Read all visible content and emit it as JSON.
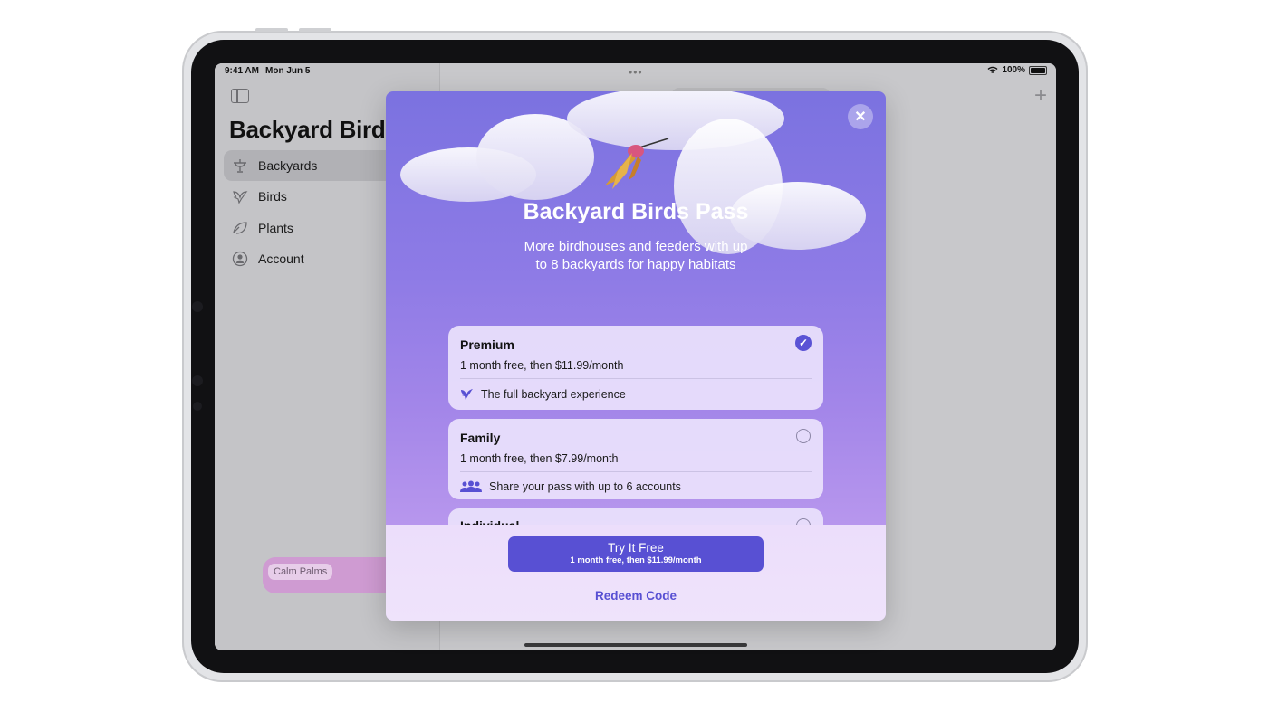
{
  "status_bar": {
    "time": "9:41 AM",
    "date": "Mon Jun 5",
    "battery": "100%"
  },
  "sidebar": {
    "title": "Backyard Birds",
    "items": [
      {
        "label": "Backyards",
        "icon": "birdbath-icon",
        "selected": true
      },
      {
        "label": "Birds",
        "icon": "bird-icon",
        "selected": false
      },
      {
        "label": "Plants",
        "icon": "leaf-icon",
        "selected": false
      },
      {
        "label": "Account",
        "icon": "person-circle-icon",
        "selected": false
      }
    ]
  },
  "main": {
    "cards": [
      {
        "name": ""
      },
      {
        "name": ""
      },
      {
        "name": "Calm Palms"
      }
    ]
  },
  "pass_sheet": {
    "title": "Backyard Birds Pass",
    "subtitle": "More birdhouses and feeders with up to 8 backyards for happy habitats",
    "options": [
      {
        "name": "Premium",
        "price": "1 month free, then $11.99/month",
        "feature": "The full backyard experience",
        "selected": true
      },
      {
        "name": "Family",
        "price": "1 month free, then $7.99/month",
        "feature": "Share your pass with up to 6 accounts",
        "selected": false
      },
      {
        "name": "Individual",
        "selected": false
      }
    ],
    "cta_label": "Try It Free",
    "cta_detail": "1 month free, then $11.99/month",
    "redeem_label": "Redeem Code"
  },
  "colors": {
    "accent": "#5850d3",
    "sheet_top": "#7b72e0",
    "sheet_bottom": "#c8a4f1"
  }
}
